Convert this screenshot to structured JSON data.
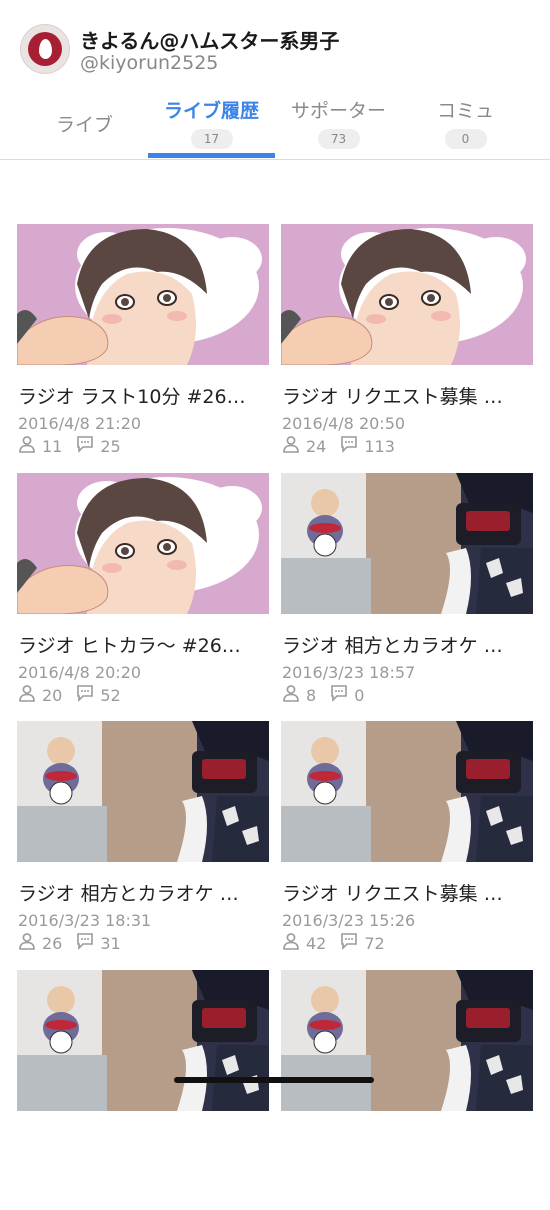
{
  "profile": {
    "display_name": "きよるん@ハムスター系男子",
    "handle": "@kiyorun2525",
    "avatar_icon": "egg-logo-icon",
    "avatar_color": "#a61f32"
  },
  "tabs": [
    {
      "label": "ライブ",
      "count": null,
      "active": false
    },
    {
      "label": "ライブ履歴",
      "count": "17",
      "active": true
    },
    {
      "label": "サポーター",
      "count": "73",
      "active": false
    },
    {
      "label": "コミュ",
      "count": "0",
      "active": false
    }
  ],
  "accent_color": "#3d84e8",
  "lives": [
    {
      "title": "ラジオ ラスト10分 #26…",
      "date": "2016/4/8 21:20",
      "viewers": "11",
      "comments": "25",
      "thumbnail": "illustration"
    },
    {
      "title": "ラジオ リクエスト募集 …",
      "date": "2016/4/8 20:50",
      "viewers": "24",
      "comments": "113",
      "thumbnail": "illustration"
    },
    {
      "title": "ラジオ ヒトカラ〜 #26…",
      "date": "2016/4/8 20:20",
      "viewers": "20",
      "comments": "52",
      "thumbnail": "illustration"
    },
    {
      "title": "ラジオ 相方とカラオケ …",
      "date": "2016/3/23 18:57",
      "viewers": "8",
      "comments": "0",
      "thumbnail": "photo"
    },
    {
      "title": "ラジオ 相方とカラオケ …",
      "date": "2016/3/23 18:31",
      "viewers": "26",
      "comments": "31",
      "thumbnail": "photo"
    },
    {
      "title": "ラジオ リクエスト募集 …",
      "date": "2016/3/23 15:26",
      "viewers": "42",
      "comments": "72",
      "thumbnail": "photo"
    },
    {
      "thumbnail": "photo"
    },
    {
      "thumbnail": "photo"
    }
  ]
}
